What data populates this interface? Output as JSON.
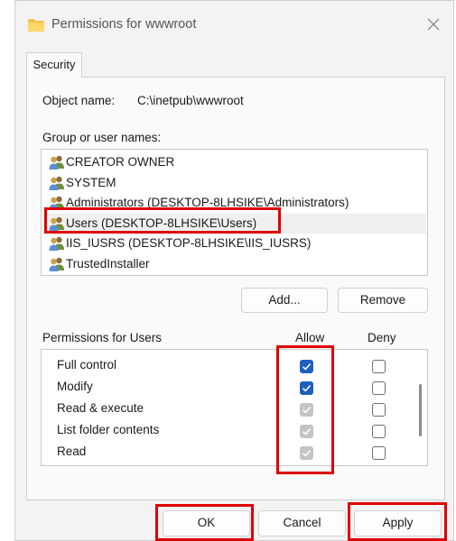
{
  "window": {
    "title": "Permissions for wwwroot",
    "icon": "folder-icon"
  },
  "tabs": [
    {
      "label": "Security"
    }
  ],
  "object": {
    "label": "Object name:",
    "value": "C:\\inetpub\\wwwroot"
  },
  "groups": {
    "label": "Group or user names:",
    "items": [
      {
        "name": "CREATOR OWNER"
      },
      {
        "name": "SYSTEM"
      },
      {
        "name": "Administrators (DESKTOP-8LHSIKE\\Administrators)"
      },
      {
        "name": "Users (DESKTOP-8LHSIKE\\Users)",
        "selected": true
      },
      {
        "name": "IIS_IUSRS (DESKTOP-8LHSIKE\\IIS_IUSRS)"
      },
      {
        "name": "TrustedInstaller"
      }
    ],
    "add_label": "Add...",
    "remove_label": "Remove"
  },
  "permissions": {
    "label": "Permissions for Users",
    "allow_header": "Allow",
    "deny_header": "Deny",
    "rows": [
      {
        "name": "Full control",
        "allow": "checked",
        "deny": "unchecked"
      },
      {
        "name": "Modify",
        "allow": "checked",
        "deny": "unchecked"
      },
      {
        "name": "Read & execute",
        "allow": "inherited",
        "deny": "unchecked"
      },
      {
        "name": "List folder contents",
        "allow": "inherited",
        "deny": "unchecked"
      },
      {
        "name": "Read",
        "allow": "inherited",
        "deny": "unchecked"
      },
      {
        "name": "",
        "allow": "checked",
        "deny": "unchecked"
      }
    ]
  },
  "buttons": {
    "ok": "OK",
    "cancel": "Cancel",
    "apply": "Apply"
  },
  "colors": {
    "checked": "#1f5fbf",
    "inherited": "#c4c4c4",
    "highlight": "#e00000"
  }
}
